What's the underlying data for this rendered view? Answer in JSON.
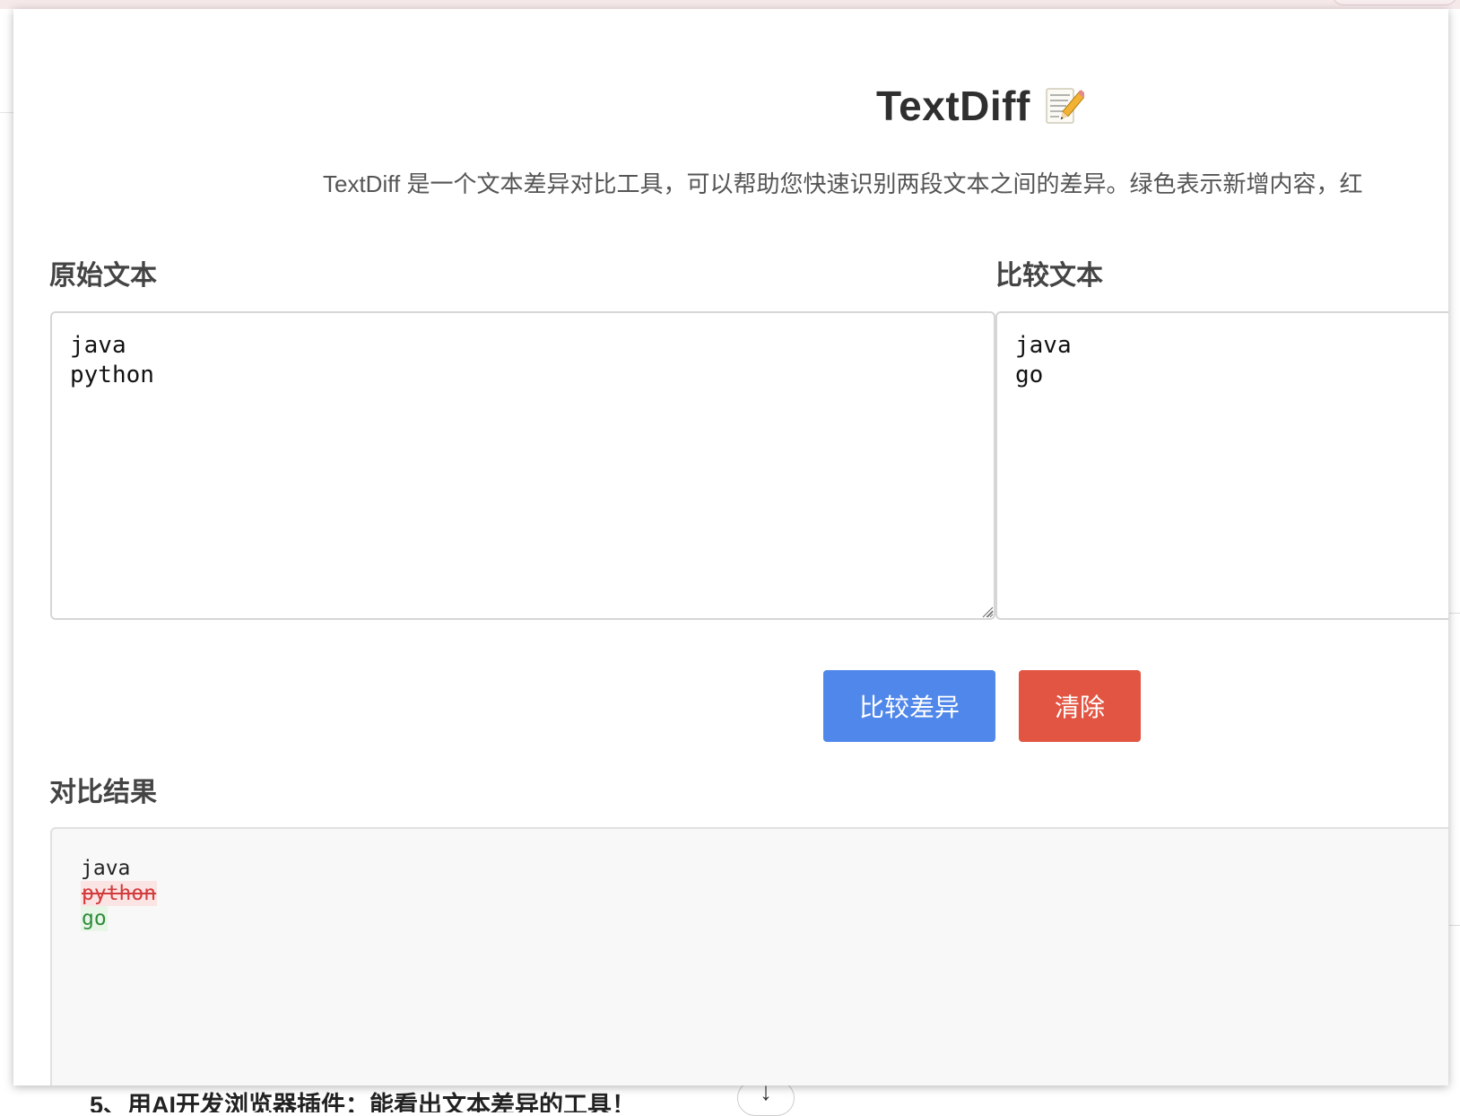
{
  "app": {
    "title": "TextDiff",
    "title_emoji": "memo-icon",
    "description": "TextDiff 是一个文本差异对比工具，可以帮助您快速识别两段文本之间的差异。绿色表示新增内容，红"
  },
  "original": {
    "label": "原始文本",
    "value": "java\npython"
  },
  "compare": {
    "label": "比较文本",
    "value": "java\ngo"
  },
  "buttons": {
    "compare_label": "比较差异",
    "clear_label": "清除"
  },
  "result": {
    "label": "对比结果",
    "lines": [
      {
        "type": "same",
        "text": "java"
      },
      {
        "type": "removed",
        "text": "python"
      },
      {
        "type": "added",
        "text": "go"
      }
    ]
  },
  "background": {
    "bottom_text": "5、用AI开发浏览器插件：能看出文本差异的工具！"
  },
  "colors": {
    "compare_button": "#5087ea",
    "clear_button": "#e25543",
    "removed": "#d23b3b",
    "added": "#2e8b3a"
  }
}
